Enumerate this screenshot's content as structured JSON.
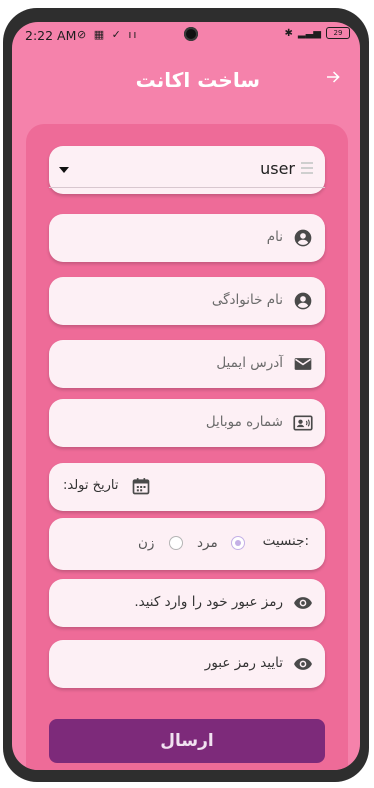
{
  "status_bar": {
    "time": "2:22 AM",
    "battery": "29"
  },
  "app_bar": {
    "title": "ساخت اکانت"
  },
  "form": {
    "role_select": {
      "value": "user"
    },
    "first_name": {
      "placeholder": "نام"
    },
    "last_name": {
      "placeholder": "نام خانوادگی"
    },
    "email": {
      "placeholder": "آدرس ایمیل"
    },
    "mobile": {
      "placeholder": "شماره موبایل"
    },
    "birth_date": {
      "label": "تاریخ تولد:"
    },
    "gender": {
      "label": "جنسیت:",
      "options": [
        "مرد",
        "زن"
      ],
      "selected": "مرد"
    },
    "password": {
      "placeholder": "رمز عبور خود را وارد کنید."
    },
    "confirm_password": {
      "placeholder": "تایید رمز عبور"
    },
    "submit_label": "ارسال"
  },
  "colors": {
    "background": "#f582ab",
    "card": "#ee6b98",
    "field": "#fdf0f5",
    "submit": "#7d2a7a"
  }
}
